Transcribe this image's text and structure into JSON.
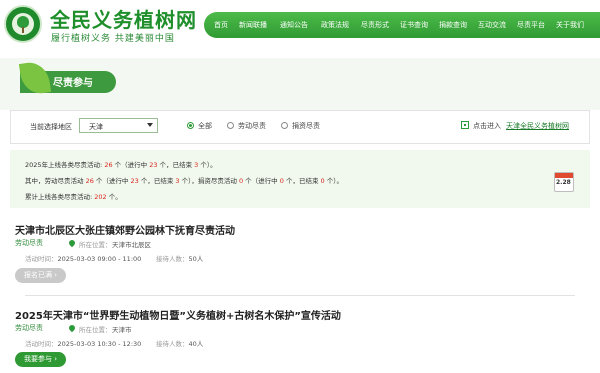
{
  "site": {
    "title": "全民义务植树网",
    "slogan": "履行植树义务  共建美丽中国"
  },
  "nav": {
    "items": [
      "首页",
      "新闻联播",
      "通知公告",
      "政策法规",
      "尽责形式",
      "证书查询",
      "捐款查询",
      "互动交流",
      "尽责平台",
      "关于我们"
    ]
  },
  "section": {
    "title": "尽责参与"
  },
  "filter": {
    "region_label": "当前选择地区",
    "region_value": "天津",
    "options": [
      "全部",
      "劳动尽责",
      "捐资尽责"
    ],
    "selected": "全部",
    "enter_prefix": "点击进入",
    "enter_link": "天津全民义务植树网"
  },
  "stats": {
    "line1": {
      "a": "2025年上线各类尽责活动: ",
      "total": "26",
      "b": " 个（进行中 ",
      "ongoing": "23",
      "c": " 个，已结束 ",
      "ended": "3",
      "d": " 个）。"
    },
    "line2": {
      "a": "其中，劳动尽责活动 ",
      "labor": "26",
      "b": " 个（进行中 ",
      "labor_ongoing": "23",
      "c": " 个，已结束 ",
      "labor_ended": "3",
      "d": " 个），捐资尽责活动 ",
      "donate": "0",
      "e": " 个（进行中 ",
      "donate_ongoing": "0",
      "f": " 个，已结束 ",
      "donate_ended": "0",
      "g": " 个）。"
    },
    "line3": {
      "a": "累计上线各类尽责活动: ",
      "cumulative": "202",
      "b": " 个。"
    },
    "calendar": "2.28"
  },
  "activities": [
    {
      "title": "天津市北辰区大张庄镇郊野公园林下抚育尽责活动",
      "type": "劳动尽责",
      "location_label": "所在位置：",
      "location": "天津市北辰区",
      "time_label": "活动时间：",
      "time": "2025-03-03 09:00 - 11:00",
      "count_label": "接待人数：",
      "count": "50人",
      "button": "报名已满 ›"
    },
    {
      "title": "2025年天津市“世界野生动植物日暨”义务植树+古树名木保护”宣传活动",
      "type": "劳动尽责",
      "location_label": "所在位置：",
      "location": "天津市",
      "time_label": "活动时间：",
      "time": "2025-03-03 10:30 - 12:30",
      "count_label": "接待人数：",
      "count": "40人",
      "button": "我要参与 ›"
    }
  ]
}
